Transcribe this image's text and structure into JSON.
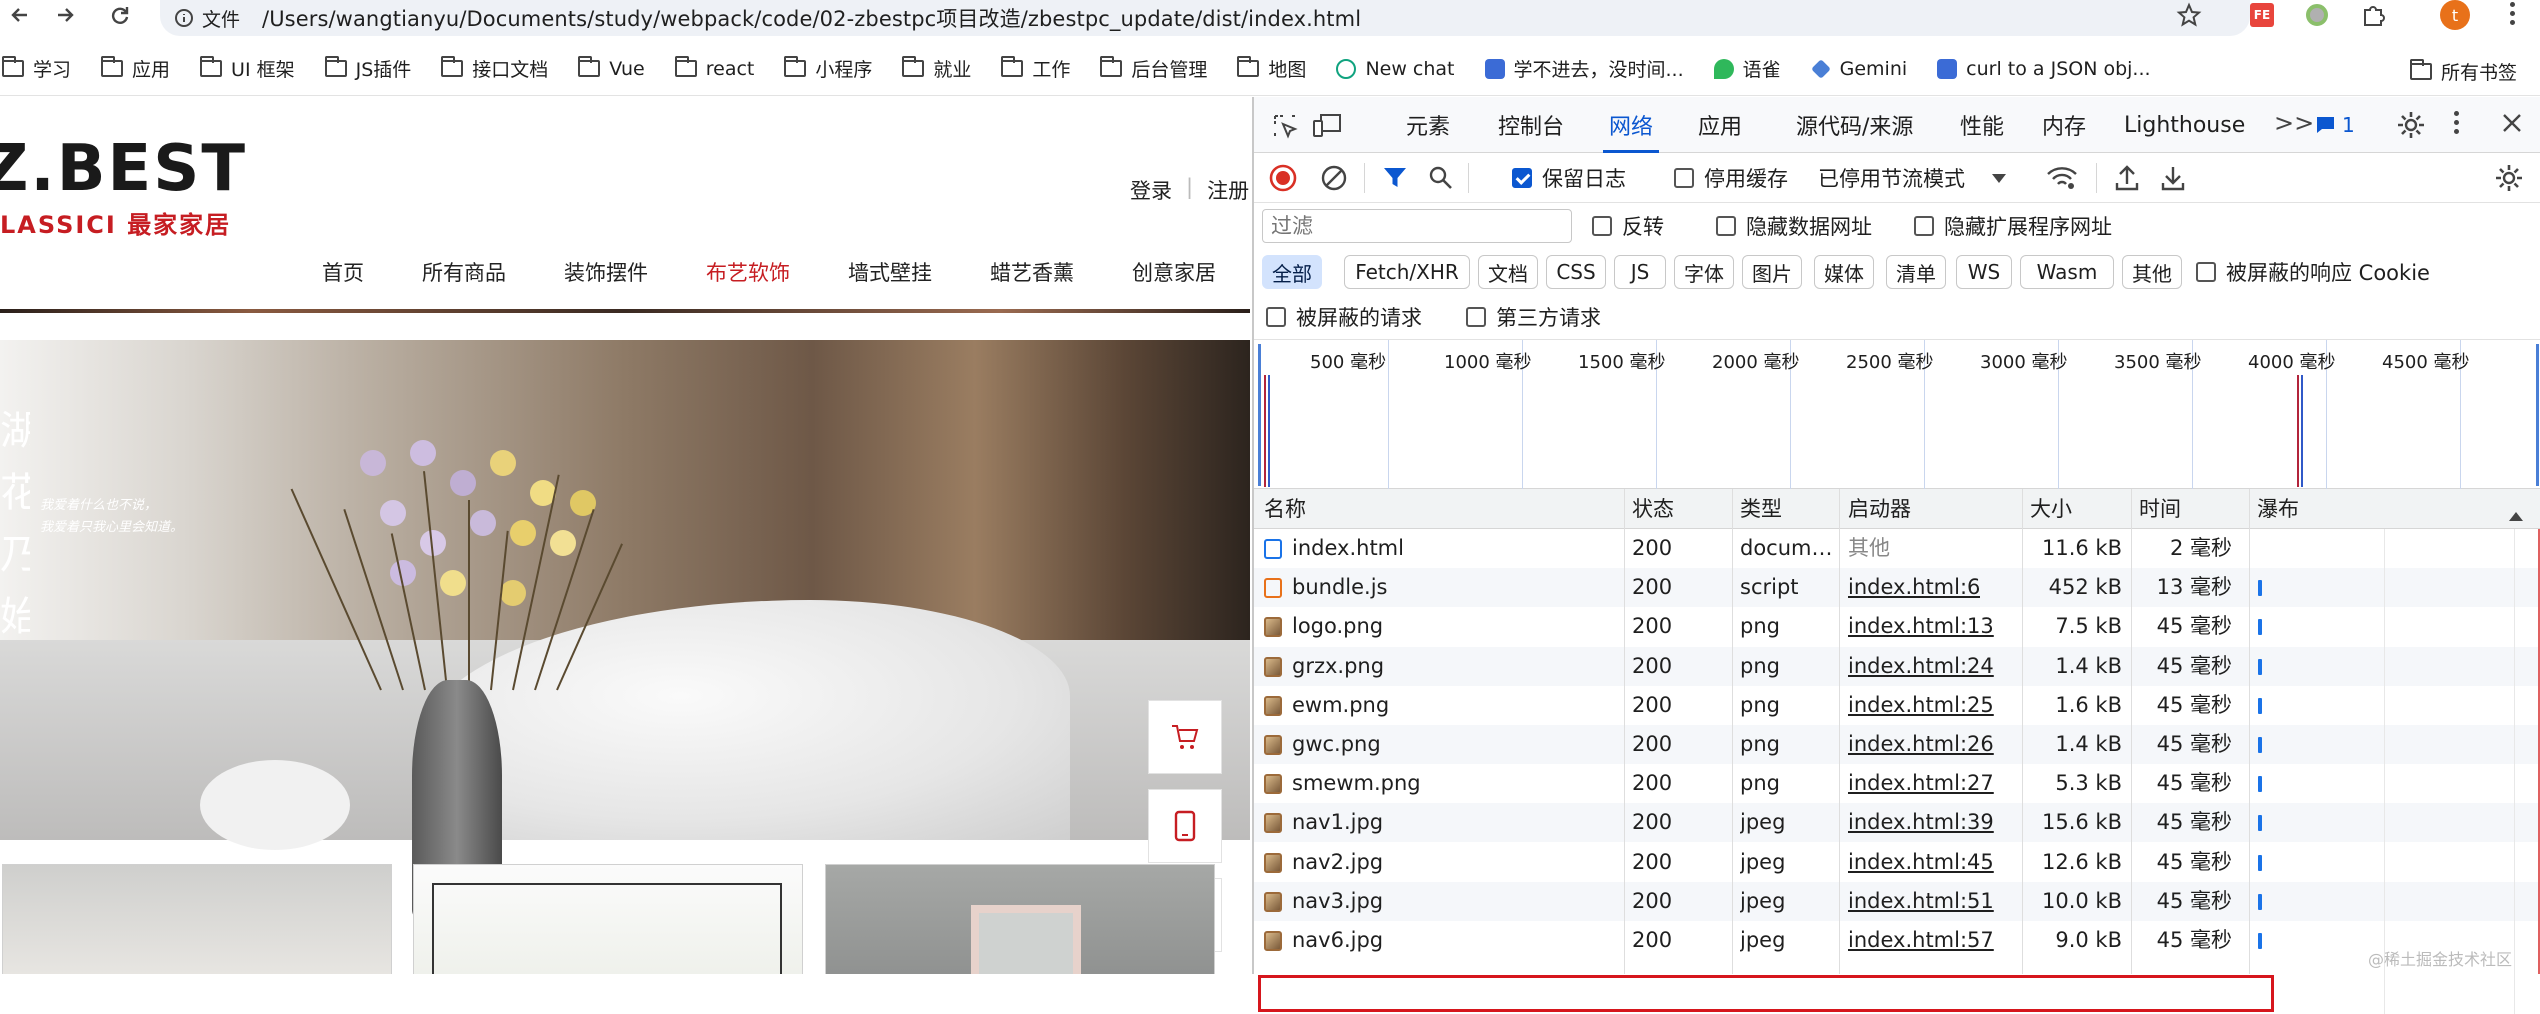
{
  "browser": {
    "address_scheme": "文件",
    "url": "/Users/wangtianyu/Documents/study/webpack/code/02-zbestpc项目改造/zbestpc_update/dist/index.html",
    "profile_initial": "t"
  },
  "bookmarks": [
    {
      "label": "学习",
      "icon": "folder-icon"
    },
    {
      "label": "应用",
      "icon": "folder-icon"
    },
    {
      "label": "UI 框架",
      "icon": "folder-icon"
    },
    {
      "label": "JS插件",
      "icon": "folder-icon"
    },
    {
      "label": "接口文档",
      "icon": "folder-icon"
    },
    {
      "label": "Vue",
      "icon": "folder-icon"
    },
    {
      "label": "react",
      "icon": "folder-icon"
    },
    {
      "label": "小程序",
      "icon": "folder-icon"
    },
    {
      "label": "就业",
      "icon": "folder-icon"
    },
    {
      "label": "工作",
      "icon": "folder-icon"
    },
    {
      "label": "后台管理",
      "icon": "folder-icon"
    },
    {
      "label": "地图",
      "icon": "folder-icon"
    },
    {
      "label": "New chat",
      "icon": "openai-icon"
    },
    {
      "label": "学不进去，没时间...",
      "icon": "site-icon"
    },
    {
      "label": "语雀",
      "icon": "yuque-icon"
    },
    {
      "label": "Gemini",
      "icon": "gemini-icon"
    },
    {
      "label": "curl to a JSON obj...",
      "icon": "site-icon"
    }
  ],
  "all_bookmarks": "所有书签",
  "site": {
    "logo_main": "Z.BEST",
    "logo_sub": "LASSICI 最家家居",
    "login": "登录",
    "register": "注册",
    "nav": [
      "首页",
      "所有商品",
      "装饰摆件",
      "布艺软饰",
      "墙式壁挂",
      "蜡艺香薰",
      "创意家居"
    ],
    "nav_active_index": 3,
    "hero_line1": "我爱着什么也不说，",
    "hero_line2": "我爱着只我心里会知道。",
    "hero_vertical": "湖花乃始"
  },
  "devtools": {
    "tabs": [
      "元素",
      "控制台",
      "网络",
      "应用",
      "源代码/来源",
      "性能",
      "内存",
      "Lighthouse"
    ],
    "active_tab": "网络",
    "issues_count": "1",
    "preserve_log": "保留日志",
    "disable_cache": "停用缓存",
    "throttle": "已停用节流模式",
    "filter_placeholder": "过滤",
    "invert": "反转",
    "hide_data_urls": "隐藏数据网址",
    "hide_ext_urls": "隐藏扩展程序网址",
    "types": [
      "全部",
      "Fetch/XHR",
      "文档",
      "CSS",
      "JS",
      "字体",
      "图片",
      "媒体",
      "清单",
      "WS",
      "Wasm",
      "其他"
    ],
    "blocked_cookies": "被屏蔽的响应 Cookie",
    "blocked_requests": "被屏蔽的请求",
    "third_party": "第三方请求",
    "timeline_ticks": [
      "500 毫秒",
      "1000 毫秒",
      "1500 毫秒",
      "2000 毫秒",
      "2500 毫秒",
      "3000 毫秒",
      "3500 毫秒",
      "4000 毫秒",
      "4500 毫秒",
      "500"
    ],
    "columns": [
      "名称",
      "状态",
      "类型",
      "启动器",
      "大小",
      "时间",
      "瀑布"
    ],
    "rows": [
      {
        "name": "index.html",
        "status": "200",
        "type": "docum…",
        "initiator": "其他",
        "size": "11.6 kB",
        "time": "2 毫秒",
        "icon": "document-icon"
      },
      {
        "name": "bundle.js",
        "status": "200",
        "type": "script",
        "initiator": "index.html:6",
        "size": "452 kB",
        "time": "13 毫秒",
        "icon": "script-icon"
      },
      {
        "name": "logo.png",
        "status": "200",
        "type": "png",
        "initiator": "index.html:13",
        "size": "7.5 kB",
        "time": "45 毫秒",
        "icon": "image-icon"
      },
      {
        "name": "grzx.png",
        "status": "200",
        "type": "png",
        "initiator": "index.html:24",
        "size": "1.4 kB",
        "time": "45 毫秒",
        "icon": "image-icon"
      },
      {
        "name": "ewm.png",
        "status": "200",
        "type": "png",
        "initiator": "index.html:25",
        "size": "1.6 kB",
        "time": "45 毫秒",
        "icon": "image-icon"
      },
      {
        "name": "gwc.png",
        "status": "200",
        "type": "png",
        "initiator": "index.html:26",
        "size": "1.4 kB",
        "time": "45 毫秒",
        "icon": "image-icon"
      },
      {
        "name": "smewm.png",
        "status": "200",
        "type": "png",
        "initiator": "index.html:27",
        "size": "5.3 kB",
        "time": "45 毫秒",
        "icon": "image-icon"
      },
      {
        "name": "nav1.jpg",
        "status": "200",
        "type": "jpeg",
        "initiator": "index.html:39",
        "size": "15.6 kB",
        "time": "45 毫秒",
        "icon": "image-icon"
      },
      {
        "name": "nav2.jpg",
        "status": "200",
        "type": "jpeg",
        "initiator": "index.html:45",
        "size": "12.6 kB",
        "time": "45 毫秒",
        "icon": "image-icon"
      },
      {
        "name": "nav3.jpg",
        "status": "200",
        "type": "jpeg",
        "initiator": "index.html:51",
        "size": "10.0 kB",
        "time": "45 毫秒",
        "icon": "image-icon"
      },
      {
        "name": "nav6.jpg",
        "status": "200",
        "type": "jpeg",
        "initiator": "index.html:57",
        "size": "9.0 kB",
        "time": "45 毫秒",
        "icon": "image-icon"
      }
    ],
    "highlight_row": "bundle.js"
  },
  "watermark": "@稀土掘金技术社区",
  "colors": {
    "accent": "#0b57d0",
    "brand_red": "#c61d22",
    "highlight": "#d6161d"
  }
}
